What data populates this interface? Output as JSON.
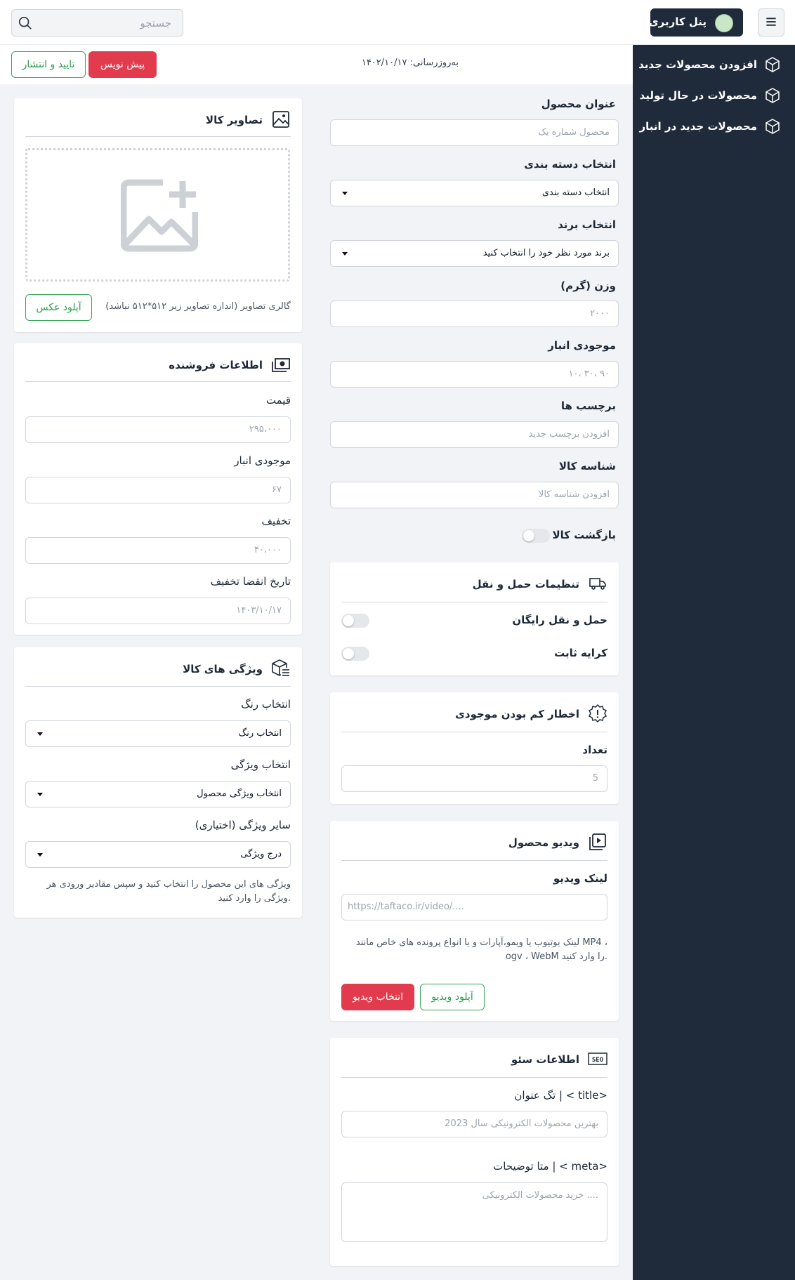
{
  "header": {
    "search_placeholder": "جستجو",
    "panel_label": "پنل کاربری"
  },
  "sidebar": {
    "items": [
      {
        "label": "افزودن محصولات جدید",
        "icon": "box-icon"
      },
      {
        "label": "محصولات در حال تولید",
        "icon": "box-icon"
      },
      {
        "label": "محصولات جدید در انبار",
        "icon": "box-icon"
      }
    ]
  },
  "toolbar": {
    "updated_label": "به‌روزرسانی:",
    "updated_date": "۱۴۰۲/۱۰/۱۷",
    "draft_label": "پیش نویس",
    "publish_label": "تایید و انتشار"
  },
  "product": {
    "title_label": "عنوان محصول",
    "title_placeholder": "محصول شماره یک",
    "category_label": "انتخاب دسته بندی",
    "category_value": "انتخاب دسته بندی",
    "brand_label": "انتخاب برند",
    "brand_value": "برند مورد نظر خود را انتخاب کنید",
    "weight_label": "وزن (گرم)",
    "weight_placeholder": "۲۰۰۰",
    "stock_label": "موجودی انبار",
    "stock_placeholder": "۱۰، ۳۰، ۹۰",
    "tags_label": "برچسب ها",
    "tags_placeholder": "افزودن برچسب جدید",
    "sku_label": "شناسه کالا",
    "sku_placeholder": "افزودن شناسه کالا",
    "return_label": "بازگشت کالا"
  },
  "shipping": {
    "title": "تنظیمات حمل و نقل",
    "free_label": "حمل و نقل رایگان",
    "fixed_label": "کرایه ثابت"
  },
  "low_stock": {
    "title": "اخطار کم بودن موجودی",
    "count_label": "تعداد",
    "count_placeholder": "5"
  },
  "video": {
    "title": "ویدیو محصول",
    "link_label": "لینک ویدیو",
    "link_placeholder": "https://taftaco.ir/video/....",
    "note": "لینک یوتیوب یا ویمو،آپارات و یا انواع پرونده های خاص مانند MP4 ، ogv ، WebM را وارد کنید.",
    "upload_label": "آپلود ویدیو",
    "choose_label": "انتخاب ویدیو"
  },
  "seo": {
    "title": "اطلاعات سئو",
    "tag_label": "تگ عنوان | < title>",
    "tag_placeholder": "بهترین محصولات الکترونیکی سال 2023",
    "meta_label": "متا توضیحات | < meta>",
    "meta_placeholder": "خرید محصولات الکترونیکی ...."
  },
  "images": {
    "title": "تصاویر کالا",
    "gallery_note": "گالری تصاویر (اندازه تصاویر زیر ۵۱۲*۵۱۲ نباشد)",
    "upload_label": "آپلود عکس"
  },
  "seller": {
    "title": "اطلاعات فروشنده",
    "price_label": "قیمت",
    "price_placeholder": "۲۹۵،۰۰۰",
    "stock_label": "موجودی انبار",
    "stock_placeholder": "۶۷",
    "discount_label": "تخفیف",
    "discount_placeholder": "۴۰،۰۰۰",
    "expiry_label": "تاریخ انقضا تخفیف",
    "expiry_placeholder": "۱۴۰۳/۱۰/۱۷"
  },
  "features": {
    "title": "ویژگی های کالا",
    "color_label": "انتخاب رنگ",
    "color_value": "انتخاب رنگ",
    "feature_label": "انتخاب ویژگی",
    "feature_value": "انتخاب ویژگی محصول",
    "other_label": "سایر ویژگی (اختیاری)",
    "other_value": "درج ویژگی",
    "note": "ویژگی های این محصول را انتخاب کنید و سپس مقادیر ورودی هر ویژگی را وارد کنید."
  },
  "colors": {
    "sidebar": "#1f2a3a",
    "accent_red": "#e23b4e",
    "accent_green": "#3aa55b"
  }
}
